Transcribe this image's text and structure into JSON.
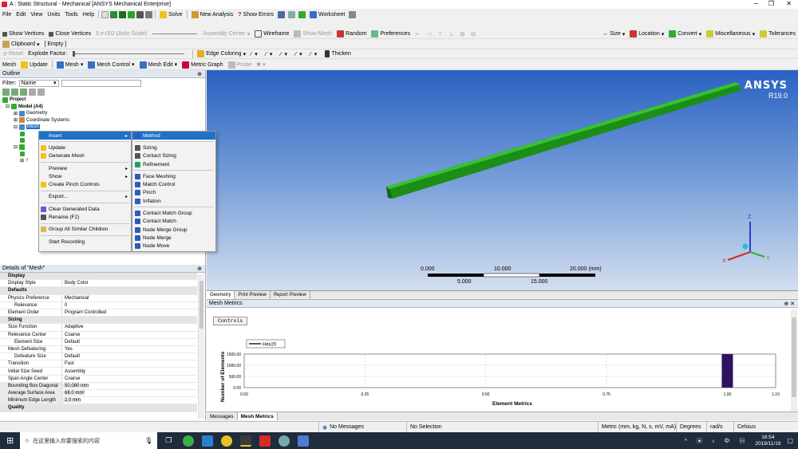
{
  "window": {
    "title": "A : Static Structural - Mechanical [ANSYS Mechanical Enterprise]"
  },
  "menu": [
    "File",
    "Edit",
    "View",
    "Units",
    "Tools",
    "Help"
  ],
  "toolbar1": {
    "solve": "Solve",
    "new_analysis": "New Analysis",
    "show_errors": "Show Errors",
    "worksheet": "Worksheet"
  },
  "toolbar2": {
    "show_vertices": "Show Vertices",
    "close_vertices": "Close Vertices",
    "autoscale": "5.e-002 (Auto Scale)",
    "assembly_center": "Assembly Center",
    "wireframe": "Wireframe",
    "show_mesh": "Show Mesh",
    "random": "Random",
    "preferences": "Preferences",
    "size": "Size",
    "location": "Location",
    "convert": "Convert",
    "miscellaneous": "Miscellaneous",
    "tolerances": "Tolerances"
  },
  "toolbar3": {
    "clipboard": "Clipboard",
    "empty": "[ Empty ]",
    "reset": "Reset",
    "explode_factor": "Explode Factor:",
    "edge_coloring": "Edge Coloring",
    "thicken": "Thicken"
  },
  "toolbar4": {
    "mesh": "Mesh",
    "update": "Update",
    "mesh_dd": "Mesh",
    "mesh_control": "Mesh Control",
    "mesh_edit": "Mesh Edit",
    "metric_graph": "Metric Graph",
    "probe": "Probe"
  },
  "outline": {
    "header": "Outline",
    "filter_label": "Filter:",
    "filter_value": "Name",
    "tree": [
      "Project",
      "Model (A4)",
      "Geometry",
      "Coordinate Systems",
      "Mesh"
    ]
  },
  "context_menu": {
    "items": [
      {
        "label": "Insert",
        "arrow": "▸",
        "icon": "none"
      },
      {
        "label": "Update",
        "icon": "lightning-icon"
      },
      {
        "label": "Generate Mesh",
        "icon": "lightning-icon"
      },
      {
        "label": "Preview",
        "arrow": "▸"
      },
      {
        "label": "Show",
        "arrow": "▸"
      },
      {
        "label": "Create Pinch Controls",
        "icon": "lightning-icon"
      },
      {
        "label": "Export...",
        "arrow": "▸"
      },
      {
        "label": "Clear Generated Data",
        "icon": "clear-data-icon"
      },
      {
        "label": "Rename (F2)",
        "icon": "rename-icon"
      },
      {
        "label": "Group All Similar Children",
        "icon": "folder-icon"
      },
      {
        "label": "Start Recording"
      }
    ]
  },
  "submenu": {
    "items": [
      "Method",
      "Sizing",
      "Contact Sizing",
      "Refinement",
      "Face Meshing",
      "Match Control",
      "Pinch",
      "Inflation",
      "Contact Match Group",
      "Contact Match",
      "Node Merge Group",
      "Node Merge",
      "Node Move"
    ]
  },
  "details": {
    "header": "Details of \"Mesh\"",
    "rows": [
      {
        "cat": "Display"
      },
      {
        "k": "Display Style",
        "v": "Body Color"
      },
      {
        "cat": "Defaults"
      },
      {
        "k": "Physics Preference",
        "v": "Mechanical"
      },
      {
        "k": "Relevance",
        "v": "0",
        "indent": true
      },
      {
        "k": "Element Order",
        "v": "Program Controlled"
      },
      {
        "cat": "Sizing"
      },
      {
        "k": "Size Function",
        "v": "Adaptive"
      },
      {
        "k": "Relevance Center",
        "v": "Coarse"
      },
      {
        "k": "Element Size",
        "v": "Default",
        "indent": true
      },
      {
        "k": "Mesh Defeaturing",
        "v": "Yes"
      },
      {
        "k": "Defeature Size",
        "v": "Default",
        "indent": true
      },
      {
        "k": "Transition",
        "v": "Fast"
      },
      {
        "k": "Initial Size Seed",
        "v": "Assembly"
      },
      {
        "k": "Span Angle Center",
        "v": "Coarse"
      },
      {
        "k": "Bounding Box Diagonal",
        "v": "50.080 mm",
        "grey": true
      },
      {
        "k": "Average Surface Area",
        "v": "68.0 mm²",
        "grey": true
      },
      {
        "k": "Minimum Edge Length",
        "v": "2.0 mm",
        "grey": true
      },
      {
        "cat": "Quality"
      }
    ]
  },
  "viewport": {
    "brand": "ANSYS",
    "version": "R19.0",
    "scale": {
      "top": [
        "0.000",
        "10.000",
        "20.000 (mm)"
      ],
      "bottom": [
        "5.000",
        "15.000"
      ]
    },
    "axes": {
      "x": "X",
      "y": "Y",
      "z": "Z"
    }
  },
  "view_tabs": [
    "Geometry",
    "Print Preview",
    "Report Preview"
  ],
  "metrics": {
    "header": "Mesh Metrics",
    "controls_label": "Controls",
    "legend": "Hex20",
    "ylabel": "Number of Elements",
    "xlabel": "Element Metrics",
    "yticks": [
      "1500.00",
      "1000.00",
      "500.00",
      "0.00"
    ],
    "xticks": [
      "0.00",
      "0.25",
      "0.50",
      "0.75",
      "1.00",
      "1.10"
    ]
  },
  "chart_data": {
    "type": "bar",
    "title": "",
    "xlabel": "Element Metrics",
    "ylabel": "Number of Elements",
    "xlim": [
      0,
      1.1
    ],
    "ylim": [
      0,
      1500
    ],
    "series": [
      {
        "name": "Hex20",
        "x": [
          1.0
        ],
        "values": [
          1500
        ]
      }
    ]
  },
  "bottom_tabs": [
    "Messages",
    "Mesh Metrics"
  ],
  "status": {
    "messages": "No Messages",
    "selection": "No Selection",
    "units": "Metric (mm, kg, N, s, mV, mA)",
    "degrees": "Degrees",
    "rad": "rad/s",
    "celsius": "Celsius"
  },
  "taskbar": {
    "search_placeholder": "在这里输入你要搜索的内容",
    "time": "16:54",
    "date": "2019/11/19"
  },
  "colors": {
    "selection": "#1e72c8",
    "beam": "#22a31c",
    "bar": "#2d1260",
    "taskbar": "#1f2c3c"
  }
}
